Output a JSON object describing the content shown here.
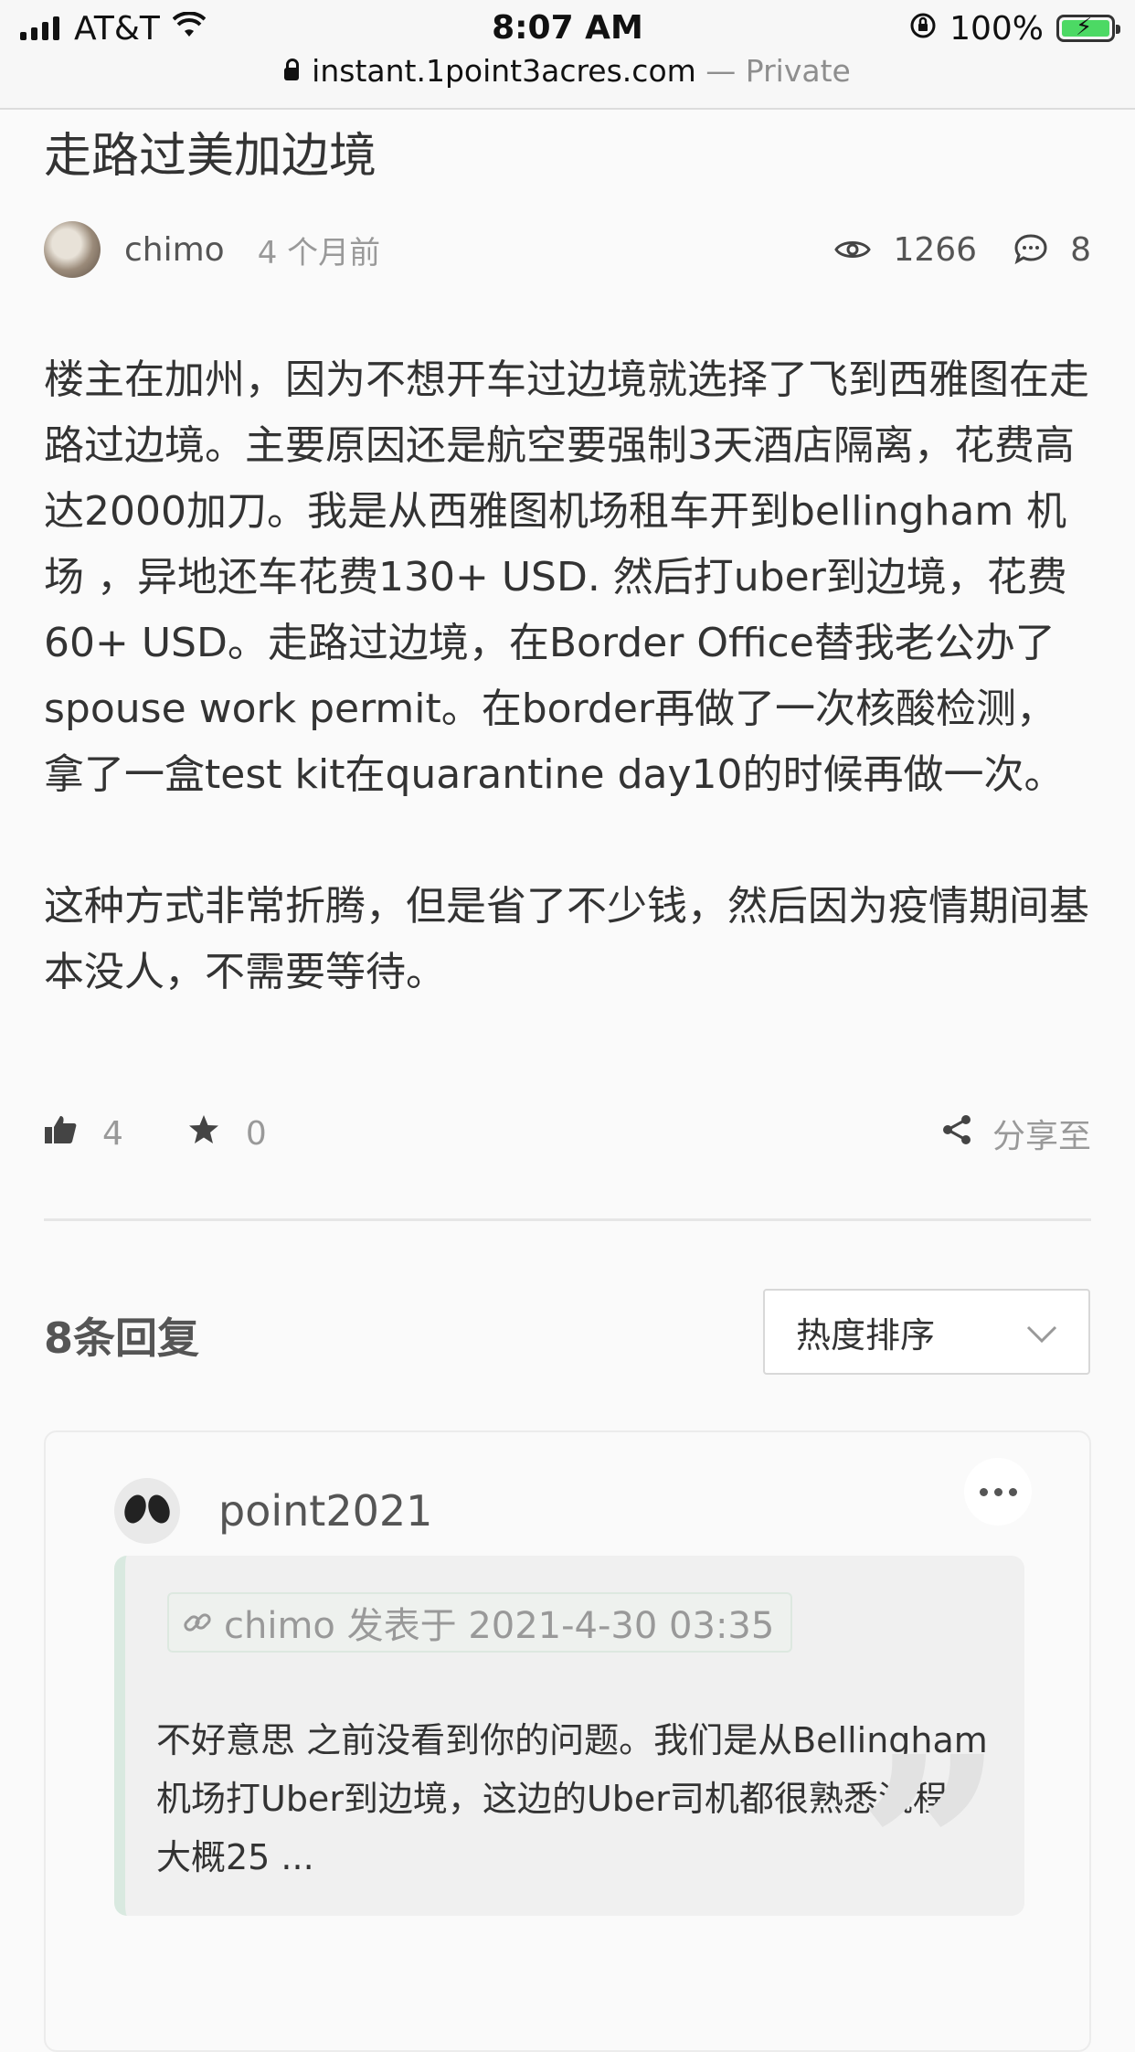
{
  "status_bar": {
    "carrier": "AT&T",
    "time": "8:07 AM",
    "battery": "100%",
    "url": "instant.1point3acres.com",
    "private_label": "— Private"
  },
  "post": {
    "title": "走路过美加边境",
    "author": "chimo",
    "time_ago": "4 个月前",
    "views": "1266",
    "comments": "8",
    "paragraphs": [
      "楼主在加州，因为不想开车过边境就选择了飞到西雅图在走路过边境。主要原因还是航空要强制3天酒店隔离，花费高达2000加刀。我是从西雅图机场租车开到bellingham 机场 ，异地还车花费130+ USD. 然后打uber到边境，花费60+ USD。走路过边境，在Border Office替我老公办了spouse work permit。在border再做了一次核酸检测，拿了一盒test kit在quarantine day10的时候再做一次。",
      "这种方式非常折腾，但是省了不少钱，然后因为疫情期间基本没人，不需要等待。"
    ],
    "likes": "4",
    "favorites": "0",
    "share_label": "分享至"
  },
  "replies": {
    "count_label": "8条回复",
    "sort_label": "热度排序",
    "items": [
      {
        "user": "point2021",
        "quote_ref": "chimo 发表于 2021-4-30 03:35",
        "text": "不好意思 之前没看到你的问题。我们是从Bellingham机场打Uber到边境，这边的Uber司机都很熟悉流程，大概25 ..."
      }
    ]
  },
  "colors": {
    "accent_quote_border": "#d9e9e0",
    "battery_green": "#4cd964"
  },
  "icons": [
    "signal-icon",
    "wifi-icon",
    "orientation-lock-icon",
    "battery-icon",
    "lock-icon",
    "eye-icon",
    "comment-icon",
    "thumbs-up-icon",
    "star-icon",
    "share-icon",
    "chevron-down-icon",
    "more-icon",
    "link-icon",
    "quote-mark-icon"
  ]
}
